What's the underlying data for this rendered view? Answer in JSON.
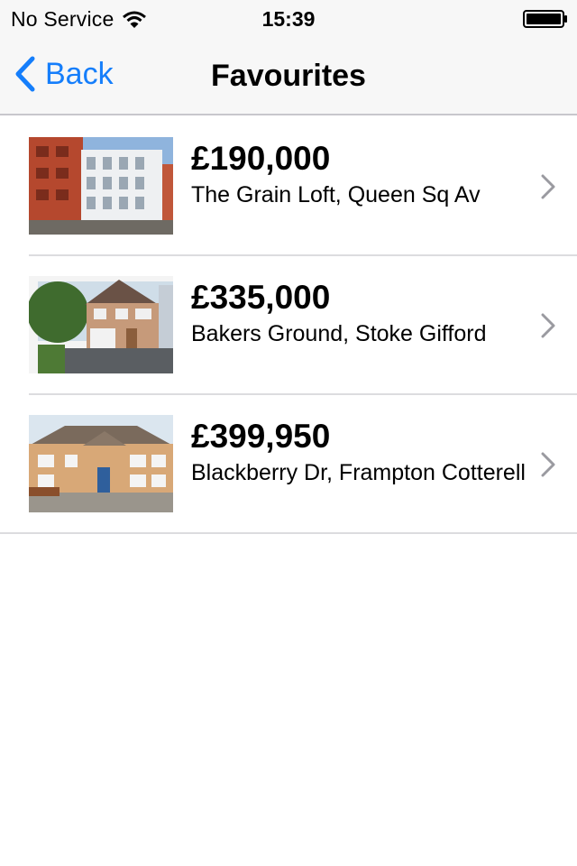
{
  "status_bar": {
    "carrier": "No Service",
    "time": "15:39",
    "icons": [
      "wifi-icon",
      "battery-icon"
    ]
  },
  "nav": {
    "back_label": "Back",
    "title": "Favourites",
    "accent_color": "#157efb"
  },
  "favourites": [
    {
      "price": "£190,000",
      "address": "The Grain Loft, Queen Sq Av",
      "thumbnail": "apartment-building-photo"
    },
    {
      "price": "£335,000",
      "address": "Bakers Ground, Stoke Gifford",
      "thumbnail": "detached-house-with-driveway-photo"
    },
    {
      "price": "£399,950",
      "address": "Blackberry Dr, Frampton Cotterell",
      "thumbnail": "brick-detached-house-photo"
    }
  ]
}
